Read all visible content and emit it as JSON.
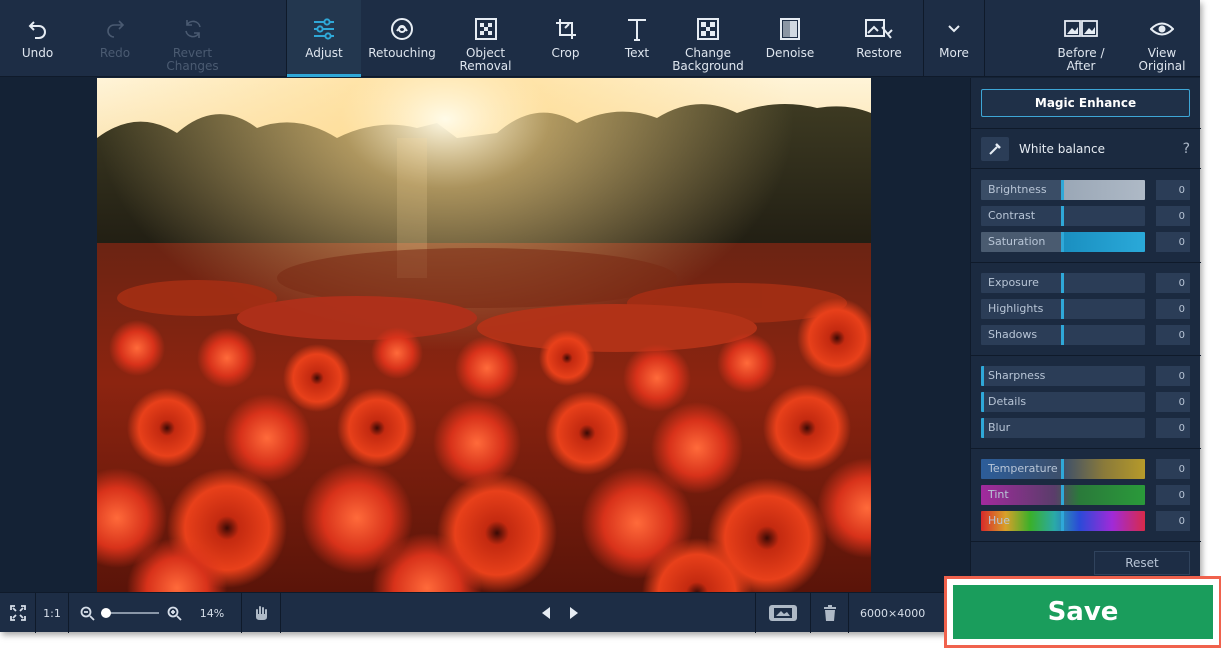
{
  "toolbar": {
    "undo": "Undo",
    "redo": "Redo",
    "revert": "Revert\nChanges",
    "adjust": "Adjust",
    "retouching": "Retouching",
    "object_removal": "Object\nRemoval",
    "crop": "Crop",
    "text": "Text",
    "change_background": "Change\nBackground",
    "denoise": "Denoise",
    "restore": "Restore",
    "more": "More",
    "before_after": "Before /\nAfter",
    "view_original": "View\nOriginal"
  },
  "panel": {
    "magic_enhance": "Magic Enhance",
    "white_balance": "White balance",
    "help": "?",
    "reset": "Reset",
    "sliders": [
      {
        "name": "Brightness",
        "value": "0"
      },
      {
        "name": "Contrast",
        "value": "0"
      },
      {
        "name": "Saturation",
        "value": "0"
      },
      {
        "name": "Exposure",
        "value": "0"
      },
      {
        "name": "Highlights",
        "value": "0"
      },
      {
        "name": "Shadows",
        "value": "0"
      },
      {
        "name": "Sharpness",
        "value": "0"
      },
      {
        "name": "Details",
        "value": "0"
      },
      {
        "name": "Blur",
        "value": "0"
      },
      {
        "name": "Temperature",
        "value": "0"
      },
      {
        "name": "Tint",
        "value": "0"
      },
      {
        "name": "Hue",
        "value": "0"
      }
    ]
  },
  "status": {
    "one_to_one": "1:1",
    "zoom_level": "14%",
    "dimensions": "6000×4000"
  },
  "save_label": "Save",
  "colors": {
    "accent": "#2fa8d8",
    "save_green": "#1a9d5c",
    "highlight_border": "#f0624d",
    "panel_bg": "#1b2a40",
    "toolbar_bg": "#1d2d45"
  }
}
